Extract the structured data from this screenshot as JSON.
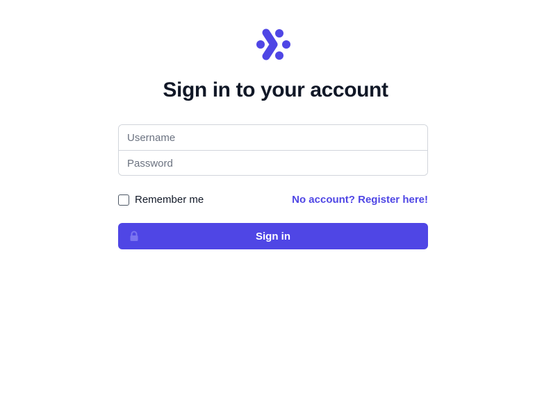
{
  "logo": {
    "icon": "brand-logo-icon",
    "color": "#4f46e5"
  },
  "heading": "Sign in to your account",
  "form": {
    "username": {
      "placeholder": "Username",
      "value": ""
    },
    "password": {
      "placeholder": "Password",
      "value": ""
    }
  },
  "remember": {
    "label": "Remember me",
    "checked": false
  },
  "register_link": "No account? Register here!",
  "signin_button": {
    "label": "Sign in",
    "icon": "lock-icon"
  },
  "colors": {
    "accent": "#4f46e5",
    "text": "#111827",
    "border": "#d1d5db",
    "muted": "#6b7280"
  }
}
